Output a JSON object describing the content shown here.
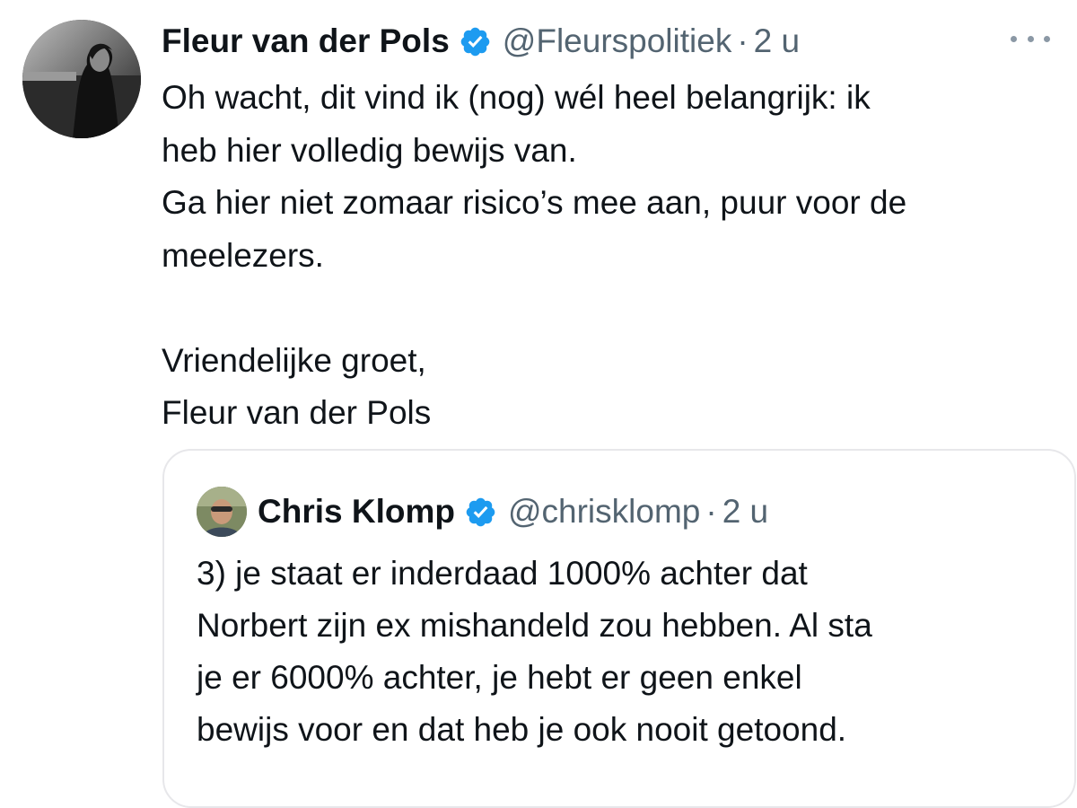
{
  "tweet": {
    "author_name": "Fleur van der Pols",
    "handle": "@Fleurspolitiek",
    "separator": "·",
    "time": "2 u",
    "verified_icon": "verified-badge-icon",
    "more_icon": "more-horizontal-icon",
    "body_lines": [
      "Oh wacht, dit vind ik (nog) wél heel belangrijk: ik",
      "heb hier volledig bewijs van.",
      "Ga hier niet zomaar risico’s mee aan, puur voor de",
      "meelezers.",
      "",
      "Vriendelijke groet,",
      "Fleur van der Pols"
    ]
  },
  "quoted_tweet": {
    "author_name": "Chris Klomp",
    "handle": "@chrisklomp",
    "separator": "·",
    "time": "2 u",
    "verified_icon": "verified-badge-icon",
    "body_lines": [
      "3) je staat er inderdaad 1000% achter dat",
      "Norbert zijn ex mishandeld zou hebben. Al sta",
      "je er 6000% achter, je hebt er geen enkel",
      "bewijs voor en dat heb je ook nooit getoond."
    ]
  },
  "colors": {
    "text_primary": "#0f1419",
    "text_secondary": "#536471",
    "verified_blue": "#1d9bf0",
    "border": "#e7e7ea"
  }
}
